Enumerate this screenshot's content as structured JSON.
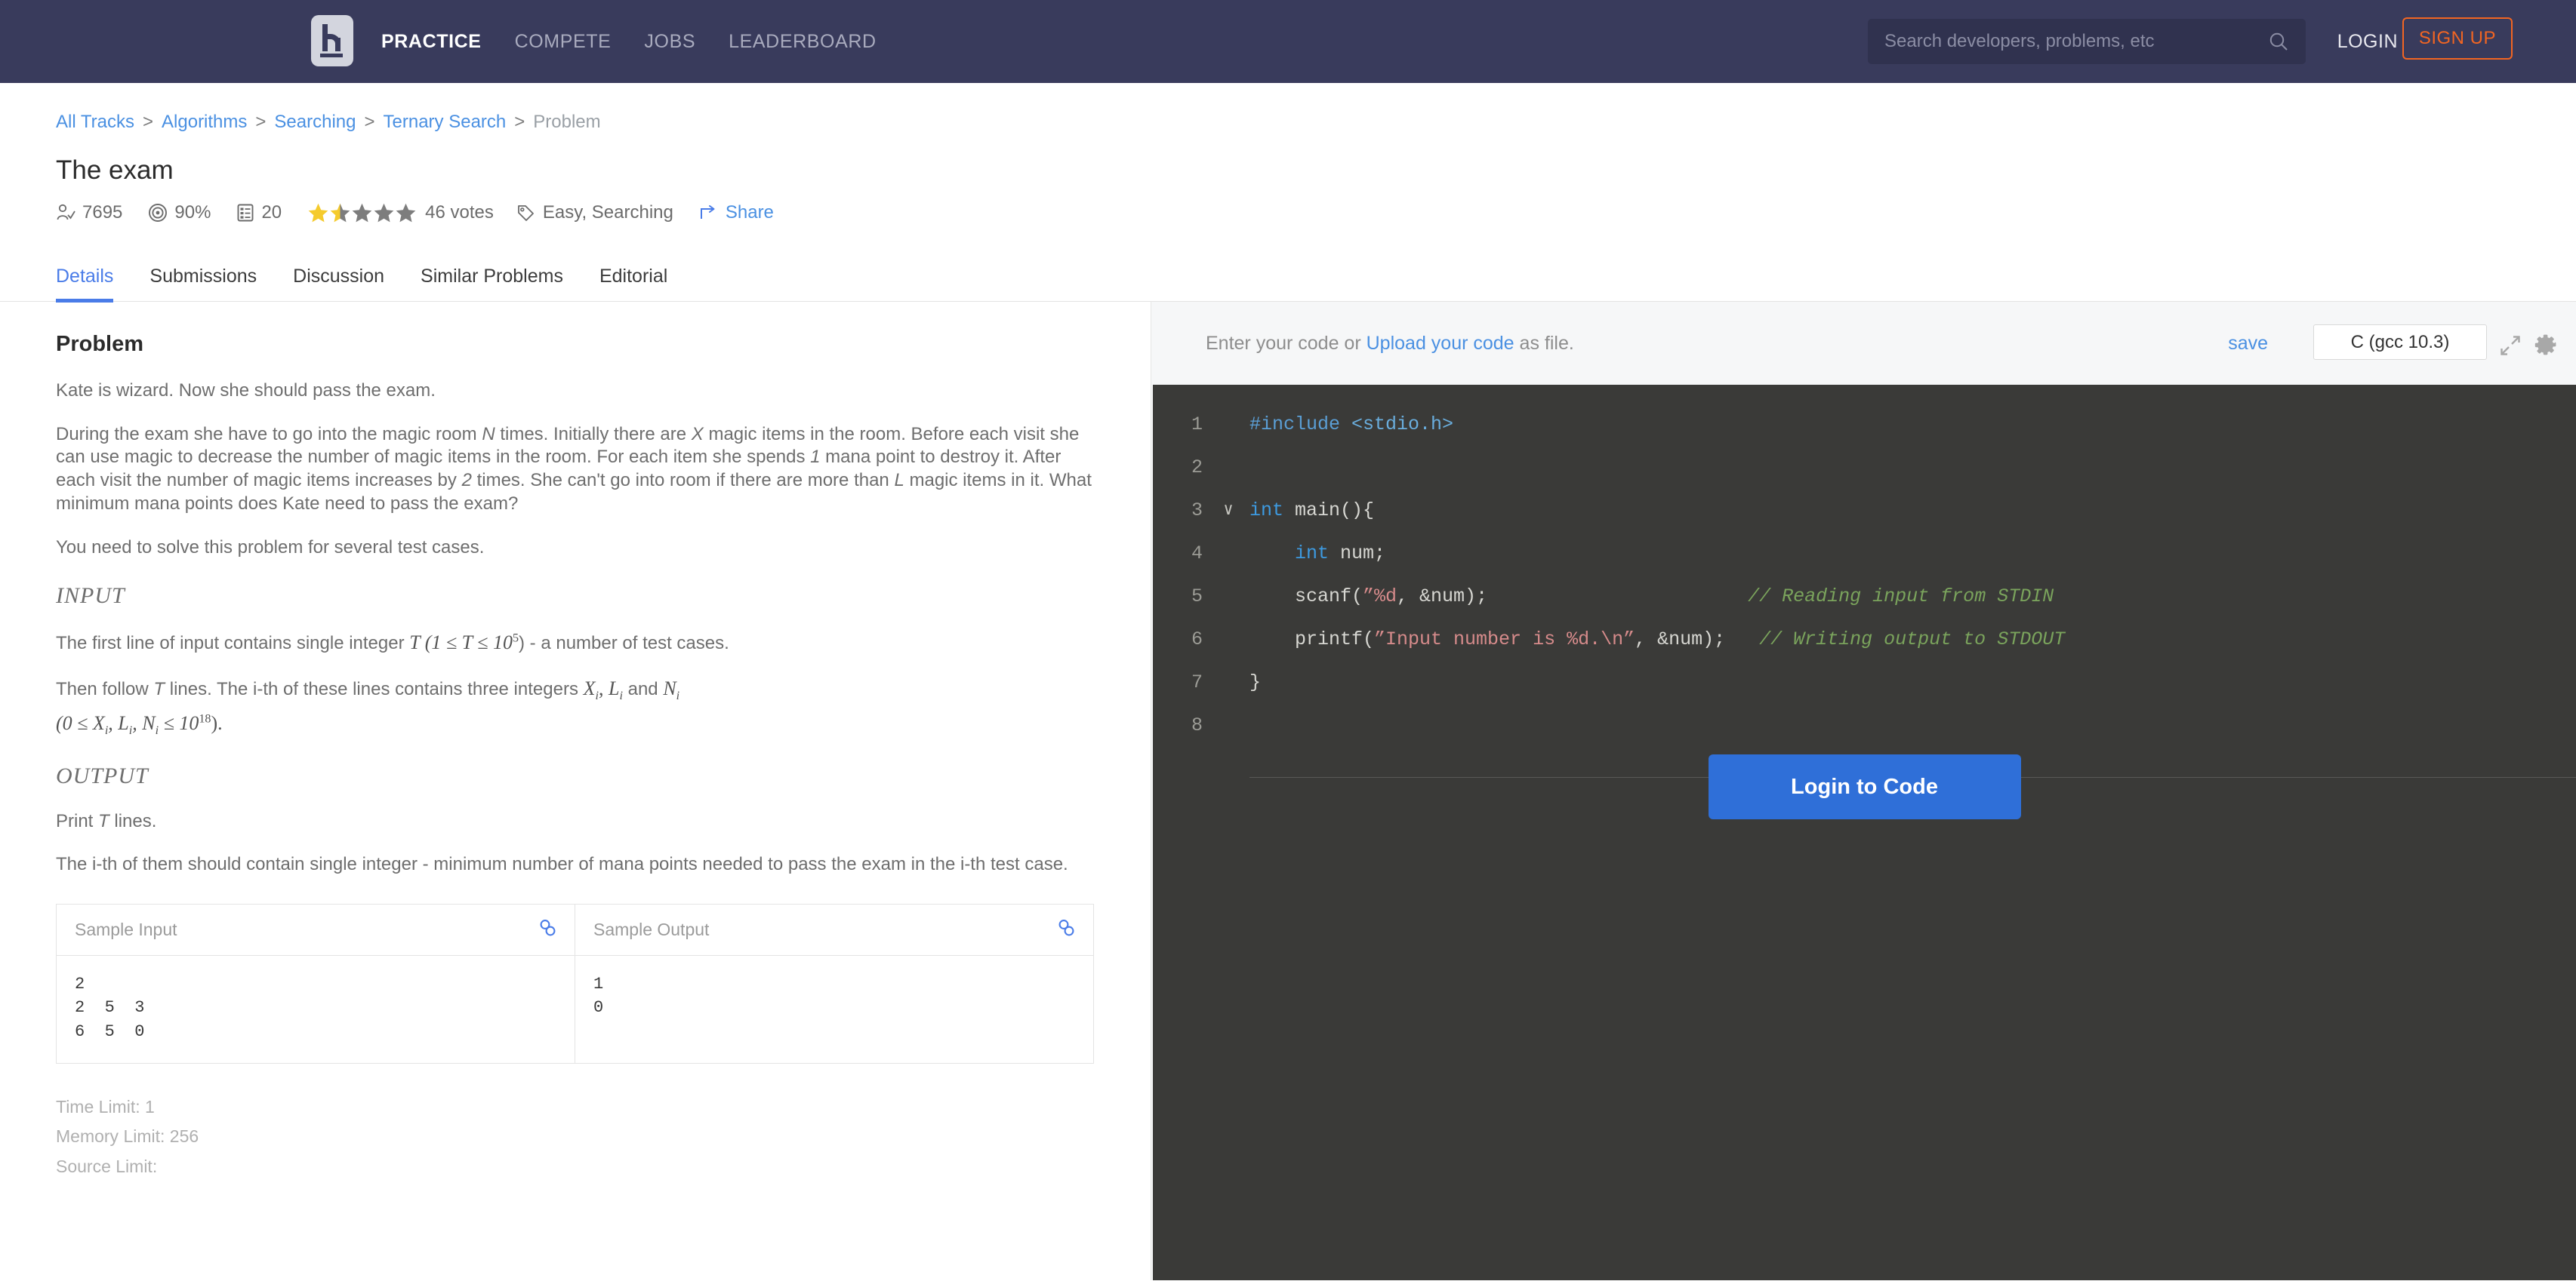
{
  "topnav": {
    "logo_alt": "HackerEarth logo",
    "links": [
      {
        "label": "PRACTICE",
        "active": true
      },
      {
        "label": "COMPETE",
        "active": false
      },
      {
        "label": "JOBS",
        "active": false
      },
      {
        "label": "LEADERBOARD",
        "active": false
      }
    ],
    "search_placeholder": "Search developers, problems, etc",
    "search_value": "",
    "login_label": "LOGIN",
    "signup_label": "SIGN UP",
    "bg_color": "#393b5c",
    "accent_color": "#f26522"
  },
  "breadcrumb": {
    "items": [
      "All Tracks",
      "Algorithms",
      "Searching",
      "Ternary Search"
    ],
    "current": "Problem",
    "separator": ">"
  },
  "problem": {
    "title": "The exam",
    "stats": {
      "solved_count": "7695",
      "accuracy": "90%",
      "submissions": "20",
      "rating_stars": 1.5,
      "votes_label": "46 votes",
      "tags_label": "Easy, Searching",
      "share_label": "Share"
    }
  },
  "tabs": [
    {
      "label": "Details",
      "active": true
    },
    {
      "label": "Submissions",
      "active": false
    },
    {
      "label": "Discussion",
      "active": false
    },
    {
      "label": "Similar Problems",
      "active": false
    },
    {
      "label": "Editorial",
      "active": false
    }
  ],
  "statement": {
    "heading": "Problem",
    "para1": "Kate is wizard. Now she should pass the exam.",
    "para2_parts": {
      "t1": "During the exam she have to go into the magic room ",
      "v1": "N",
      "t2": " times. Initially there are ",
      "v2": "X",
      "t3": " magic items in the room. Before each visit she can use magic to decrease the number of magic items in the room. For each item she spends ",
      "v3": "1",
      "t4": " mana point to destroy it. After each visit the number of magic items increases by ",
      "v4": "2",
      "t5": " times. She can't go into room if there are more than ",
      "v5": "L",
      "t6": " magic items in it. What minimum mana points does Kate need to pass the exam?"
    },
    "para3": "You need to solve this problem for several test cases.",
    "input_heading": "INPUT",
    "input_line1_pre": "The first line of input contains single integer ",
    "input_line1_math": "T (1 ≤ T ≤ 10",
    "input_line1_exp": "5",
    "input_line1_post": ") - a number of test cases.",
    "input_line2_pre": "Then follow ",
    "input_line2_T": "T",
    "input_line2_mid": " lines. The i-th of these lines contains three integers ",
    "input_line2_math1": "X",
    "input_line2_sub1": "i",
    "input_line2_comma": ", ",
    "input_line2_math2": "L",
    "input_line2_sub2": "i",
    "input_line2_and": " and ",
    "input_line2_math3": "N",
    "input_line2_sub3": "i",
    "input_line3_math": "(0 ≤ X",
    "input_line3_sub1": "i",
    "input_line3_math2": ", L",
    "input_line3_sub2": "i",
    "input_line3_math3": ", N",
    "input_line3_sub3": "i",
    "input_line3_math4": " ≤ 10",
    "input_line3_exp": "18",
    "input_line3_close": ").",
    "output_heading": "OUTPUT",
    "output_line1_pre": "Print ",
    "output_line1_T": "T",
    "output_line1_post": " lines.",
    "output_line2": "The i-th of them should contain single integer - minimum number of mana points needed to pass the exam in the i-th test case."
  },
  "sample": {
    "input_header": "Sample Input",
    "output_header": "Sample Output",
    "input_text": "2\n2  5  3\n6  5  0",
    "output_text": "1\n0"
  },
  "limits": {
    "time": "Time Limit: 1",
    "memory": "Memory Limit: 256",
    "source": "Source Limit:"
  },
  "editor": {
    "hint_pre": "Enter your code or ",
    "hint_link": "Upload your code",
    "hint_post": " as file.",
    "save_label": "save",
    "language": "C (gcc 10.3)",
    "login_button": "Login to Code",
    "lines": [
      {
        "n": "1",
        "fold": "",
        "segs": [
          {
            "t": "#include ",
            "c": "k-pre"
          },
          {
            "t": "<stdio.h>",
            "c": "k-inc"
          }
        ]
      },
      {
        "n": "2",
        "fold": "",
        "segs": []
      },
      {
        "n": "3",
        "fold": "∨",
        "segs": [
          {
            "t": "int ",
            "c": "k-type"
          },
          {
            "t": "main(){",
            "c": ""
          }
        ]
      },
      {
        "n": "4",
        "fold": "",
        "segs": [
          {
            "t": "    ",
            "c": ""
          },
          {
            "t": "int ",
            "c": "k-type"
          },
          {
            "t": "num;",
            "c": ""
          }
        ]
      },
      {
        "n": "5",
        "fold": "",
        "segs": [
          {
            "t": "    scanf(",
            "c": ""
          },
          {
            "t": "”%d",
            "c": "k-str"
          },
          {
            "t": ", &num);",
            "c": ""
          },
          {
            "t": "                       ",
            "c": ""
          },
          {
            "t": "// Reading input from STDIN",
            "c": "k-com"
          }
        ]
      },
      {
        "n": "6",
        "fold": "",
        "segs": [
          {
            "t": "    printf(",
            "c": ""
          },
          {
            "t": "”Input number is %d.\\n”",
            "c": "k-str"
          },
          {
            "t": ", &num);",
            "c": ""
          },
          {
            "t": "   ",
            "c": ""
          },
          {
            "t": "// Writing output to STDOUT",
            "c": "k-com"
          }
        ]
      },
      {
        "n": "7",
        "fold": "",
        "segs": [
          {
            "t": "}",
            "c": ""
          }
        ]
      },
      {
        "n": "8",
        "fold": "",
        "segs": []
      }
    ]
  }
}
